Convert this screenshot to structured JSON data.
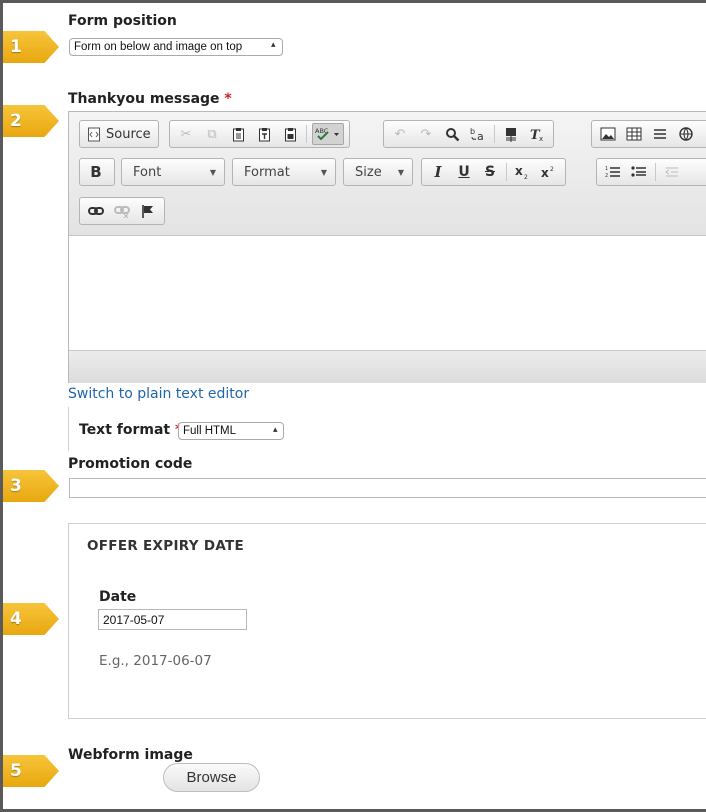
{
  "form_position": {
    "label": "Form position",
    "selected": "Form on below and image on top"
  },
  "thankyou": {
    "label": "Thankyou message",
    "required_mark": "*",
    "toolbar": {
      "source_label": "Source",
      "bold_label": "B",
      "italic_label": "I",
      "underline_label": "U",
      "strike_label": "S",
      "font_label": "Font",
      "format_label": "Format",
      "size_label": "Size"
    }
  },
  "switch_editor_link": "Switch to plain text editor",
  "text_format": {
    "label": "Text format",
    "required_mark": "*",
    "selected": "Full HTML"
  },
  "promotion_code": {
    "label": "Promotion code",
    "value": ""
  },
  "offer_expiry": {
    "legend": "OFFER EXPIRY DATE",
    "date_label": "Date",
    "date_value": "2017-05-07",
    "example": "E.g., 2017-06-07"
  },
  "webform_image": {
    "label": "Webform image",
    "browse_label": "Browse"
  },
  "callouts": [
    "1",
    "2",
    "3",
    "4",
    "5"
  ],
  "colors": {
    "callout": "#f2b824",
    "link": "#1f66a9",
    "required": "#d0201a"
  }
}
